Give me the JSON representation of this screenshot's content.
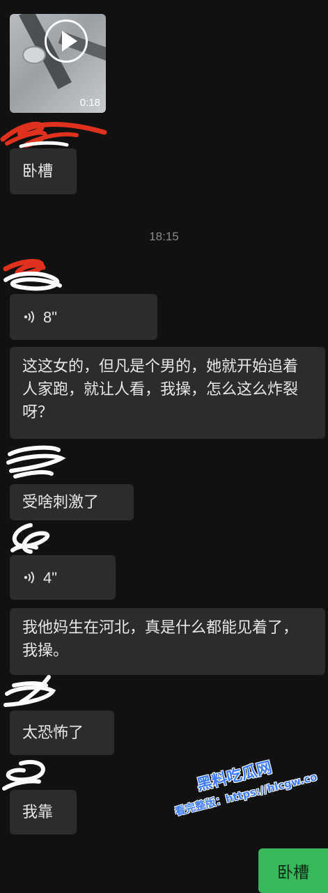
{
  "video": {
    "duration": "0:18",
    "play_icon": "play-icon"
  },
  "timestamp": "18:15",
  "messages": [
    {
      "type": "text",
      "text": "卧槽"
    },
    {
      "type": "voice",
      "icon": "voice-wave-icon",
      "length": "8\""
    },
    {
      "type": "text",
      "text": "这这女的，但凡是个男的，她就开始追着人家跑，就让人看，我操，怎么这么炸裂呀？"
    },
    {
      "type": "text",
      "text": "受啥刺激了"
    },
    {
      "type": "voice",
      "icon": "voice-wave-icon",
      "length": "4\""
    },
    {
      "type": "text",
      "text": "我他妈生在河北，真是什么都能见着了，我操。"
    },
    {
      "type": "text",
      "text": "太恐怖了"
    },
    {
      "type": "text",
      "text": "我靠"
    }
  ],
  "own_message": {
    "text": "卧槽",
    "color": "#37b95b"
  },
  "watermark": {
    "brand": "黑料吃瓜网",
    "url": "看完整版：https://hlcgw.co"
  },
  "colors": {
    "background": "#111111",
    "bubble": "#2c2c2c",
    "redaction_red": "#e0301e",
    "redaction_white": "#ffffff",
    "watermark": "#3f7cff"
  }
}
